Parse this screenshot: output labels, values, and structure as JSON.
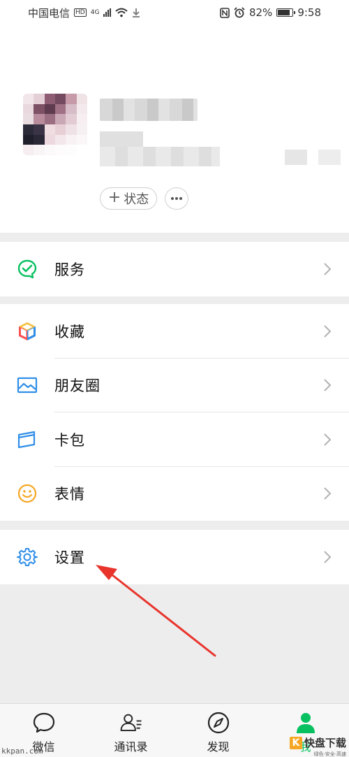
{
  "status_bar": {
    "carrier": "中国电信",
    "hd": "HD",
    "network": "4G",
    "battery": "82%",
    "battery_level": 0.82,
    "time": "9:58"
  },
  "profile": {
    "status_button": "状态"
  },
  "menu": {
    "service": "服务",
    "favorites": "收藏",
    "moments": "朋友圈",
    "cards": "卡包",
    "stickers": "表情",
    "settings": "设置"
  },
  "tabbar": {
    "chats": "微信",
    "contacts": "通讯录",
    "discover": "发现",
    "me": "我"
  },
  "watermark": {
    "site": "kkpan.com",
    "brand_k": "K",
    "brand_text": "快盘下载",
    "brand_sub": "绿色·安全·高速"
  },
  "colors": {
    "accent": "#07c160",
    "arrow": "#e8342b"
  }
}
